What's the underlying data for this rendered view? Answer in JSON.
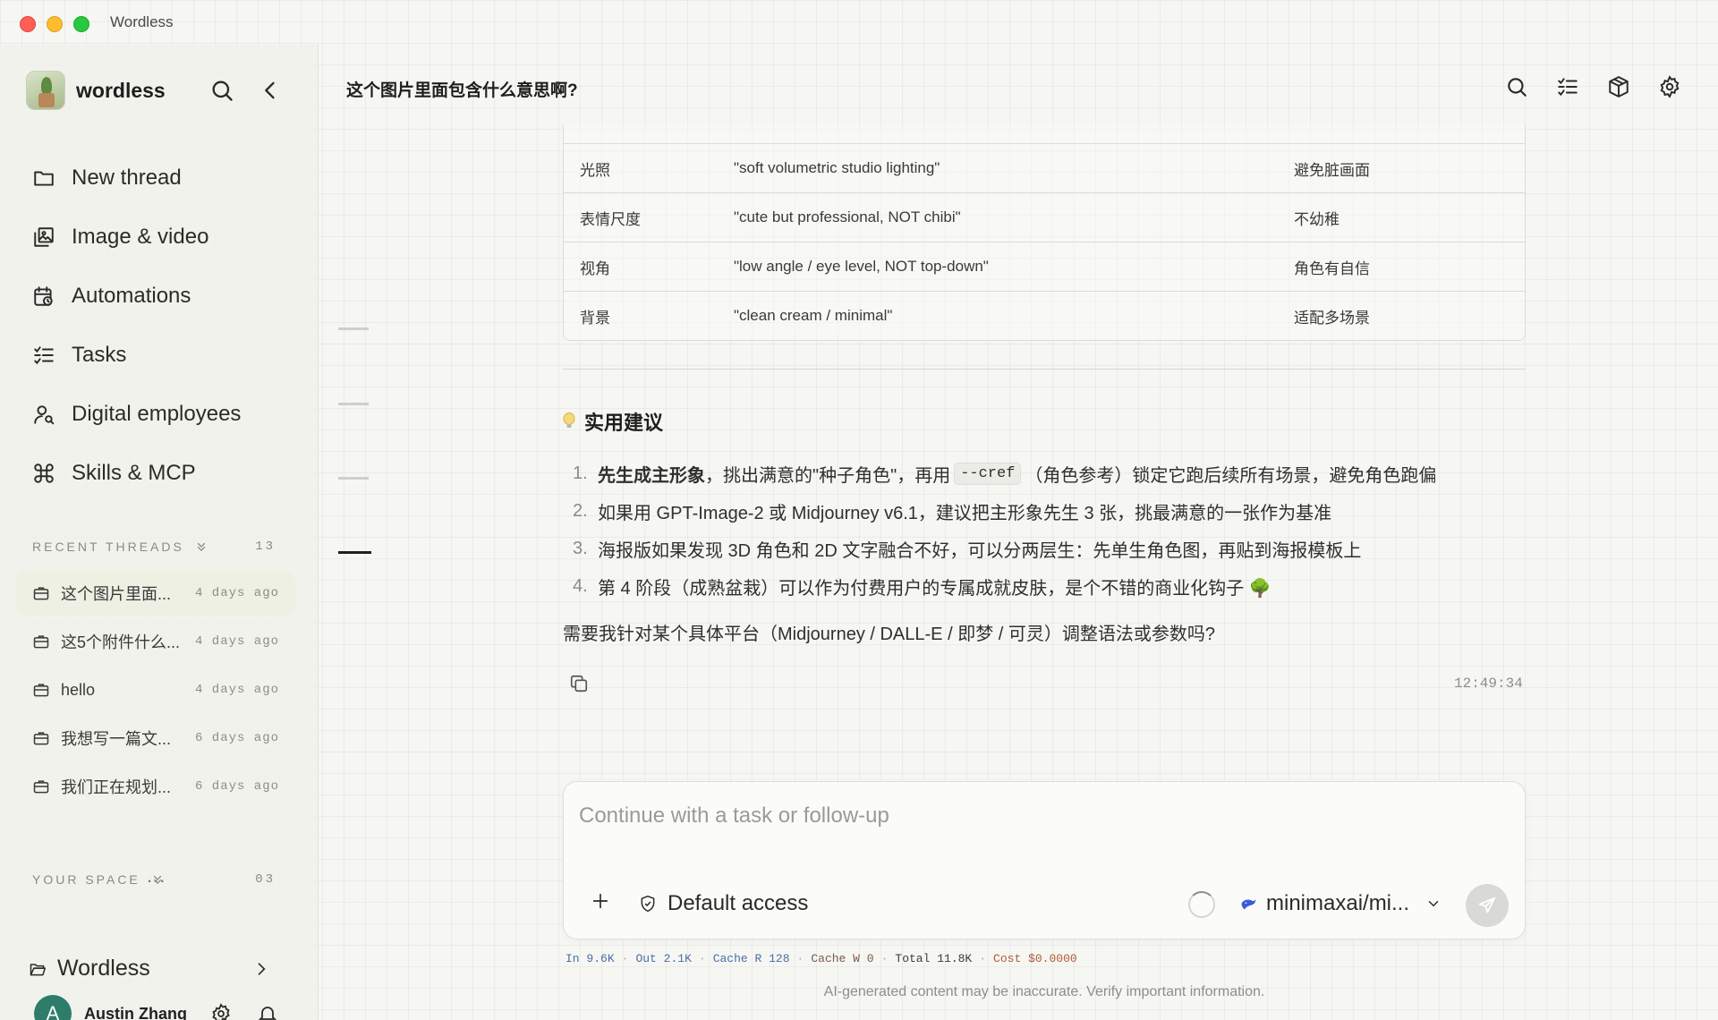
{
  "window": {
    "title": "Wordless"
  },
  "sidebar": {
    "brand": "wordless",
    "nav": [
      {
        "label": "New thread",
        "icon": "folder-icon"
      },
      {
        "label": "Image & video",
        "icon": "image-icon"
      },
      {
        "label": "Automations",
        "icon": "calendar-clock-icon"
      },
      {
        "label": "Tasks",
        "icon": "checklist-icon"
      },
      {
        "label": "Digital employees",
        "icon": "user-search-icon"
      },
      {
        "label": "Skills & MCP",
        "icon": "command-icon"
      }
    ],
    "recent": {
      "label": "RECENT THREADS",
      "count": "13",
      "threads": [
        {
          "title": "这个图片里面...",
          "time": "4 days ago"
        },
        {
          "title": "这5个附件什么...",
          "time": "4 days ago"
        },
        {
          "title": "hello",
          "time": "4 days ago"
        },
        {
          "title": "我想写一篇文...",
          "time": "6 days ago"
        },
        {
          "title": "我们正在规划...",
          "time": "6 days ago"
        }
      ],
      "more": "..."
    },
    "space": {
      "label": "YOUR SPACE",
      "count": "03",
      "name": "Wordless"
    },
    "user": {
      "initial": "A",
      "name": "Austin Zhang"
    }
  },
  "header": {
    "title": "这个图片里面包含什么意思啊?"
  },
  "table": {
    "rows": [
      [
        "光照",
        "\"soft volumetric studio lighting\"",
        "避免脏画面"
      ],
      [
        "表情尺度",
        "\"cute but professional, NOT chibi\"",
        "不幼稚"
      ],
      [
        "视角",
        "\"low angle / eye level, NOT top-down\"",
        "角色有自信"
      ],
      [
        "背景",
        "\"clean cream / minimal\"",
        "适配多场景"
      ]
    ]
  },
  "tips": {
    "title": "实用建议",
    "items": [
      {
        "num": "1.",
        "bold": "先生成主形象",
        "pre": "，挑出满意的\"种子角色\"，再用",
        "code": "--cref",
        "post": "（角色参考）锁定它跑后续所有场景，避免角色跑偏"
      },
      {
        "num": "2.",
        "text": "如果用 GPT-Image-2 或 Midjourney v6.1，建议把主形象先生 3 张，挑最满意的一张作为基准"
      },
      {
        "num": "3.",
        "text": "海报版如果发现 3D 角色和 2D 文字融合不好，可以分两层生：先单生角色图，再贴到海报模板上"
      },
      {
        "num": "4.",
        "text": "第 4 阶段（成熟盆栽）可以作为付费用户的专属成就皮肤，是个不错的商业化钩子 🌳"
      }
    ]
  },
  "question": "需要我针对某个具体平台（Midjourney / DALL-E / 即梦 / 可灵）调整语法或参数吗?",
  "message": {
    "timestamp": "12:49:34"
  },
  "composer": {
    "placeholder": "Continue with a task or follow-up",
    "access": "Default access",
    "model": "minimaxai/mi..."
  },
  "stats": {
    "in_label": "In",
    "in": "9.6K",
    "out_label": "Out",
    "out": "2.1K",
    "cache_r_label": "Cache R",
    "cache_r": "128",
    "cache_w_label": "Cache W",
    "cache_w": "0",
    "total_label": "Total",
    "total": "11.8K",
    "cost_label": "Cost",
    "cost": "$0.0000"
  },
  "disclaimer": "AI-generated content may be inaccurate. Verify important information."
}
